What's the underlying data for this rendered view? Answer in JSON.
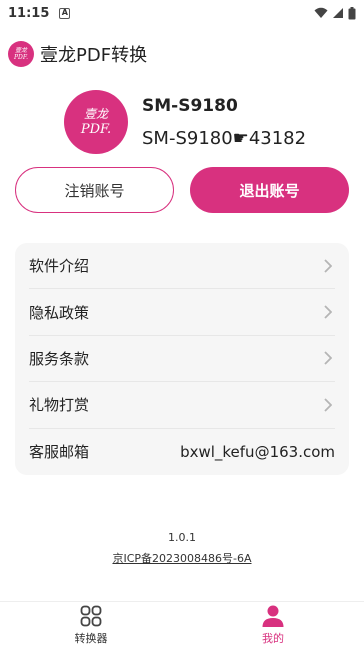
{
  "status_bar": {
    "time": "11:15",
    "notification_badge": "A",
    "icons": [
      "wifi-icon",
      "signal-icon",
      "battery-icon"
    ]
  },
  "header": {
    "logo_text_top": "壹龙",
    "logo_text_bottom": "PDF.",
    "title": "壹龙PDF转换"
  },
  "profile": {
    "avatar_text_top": "壹龙",
    "avatar_text_bottom": "PDF.",
    "device_name": "SM-S9180",
    "device_id": "SM-S9180☛43182"
  },
  "account_actions": {
    "deregister_label": "注销账号",
    "logout_label": "退出账号"
  },
  "menu": {
    "items": [
      {
        "label": "软件介绍",
        "icon": "chevron-right-icon"
      },
      {
        "label": "隐私政策",
        "icon": "chevron-right-icon"
      },
      {
        "label": "服务条款",
        "icon": "chevron-right-icon"
      },
      {
        "label": "礼物打赏",
        "icon": "chevron-right-icon"
      },
      {
        "label": "客服邮箱",
        "value": "bxwl_kefu@163.com"
      }
    ]
  },
  "footer": {
    "version": "1.0.1",
    "icp": "京ICP备2023008486号-6A"
  },
  "bottom_nav": {
    "items": [
      {
        "label": "转换器",
        "icon": "grid-icon",
        "active": false
      },
      {
        "label": "我的",
        "icon": "user-icon",
        "active": true
      }
    ]
  },
  "colors": {
    "accent": "#d8317f",
    "card_bg": "#f6f6f6",
    "divider": "#e7e7e7"
  }
}
